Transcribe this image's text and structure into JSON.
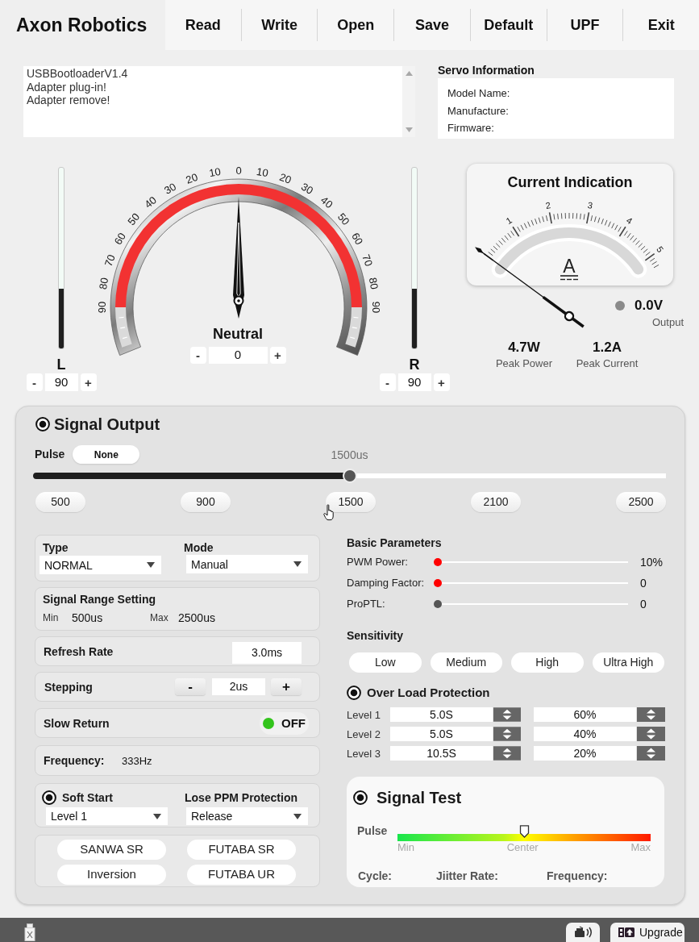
{
  "header": {
    "logo": "Axon Robotics",
    "menu": [
      "Read",
      "Write",
      "Open",
      "Save",
      "Default",
      "UPF",
      "Exit"
    ]
  },
  "log": {
    "lines": [
      "USBBootloaderV1.4",
      "Adapter plug-in!",
      "Adapter remove!"
    ]
  },
  "servo_information": {
    "title": "Servo Information",
    "fields": [
      "Model Name:",
      "Manufacture:",
      "Firmware:"
    ]
  },
  "angle_gauge": {
    "limits": [
      {
        "label": "L",
        "level": 0.33,
        "decrement": "-",
        "value": "90",
        "increment": "+"
      },
      {
        "label": "R",
        "level": 0.33,
        "decrement": "-",
        "value": "90",
        "increment": "+"
      }
    ],
    "scale_labels": [
      "90",
      "80",
      "70",
      "60",
      "50",
      "40",
      "30",
      "20",
      "10",
      "0",
      "10",
      "20",
      "30",
      "40",
      "50",
      "60",
      "70",
      "80",
      "90"
    ],
    "needle": {
      "level": 0.5
    },
    "neutral": {
      "label": "Neutral",
      "decrement": "-",
      "value": "0",
      "increment": "+"
    }
  },
  "current_indication": {
    "title": "Current Indication",
    "scale_labels": [
      "1",
      "2",
      "3",
      "4",
      "5"
    ],
    "unit": "A",
    "needle": {
      "level": 0
    },
    "output": {
      "on": false,
      "value": "0.0V",
      "label": "Output"
    },
    "peaks": [
      {
        "value": "4.7W",
        "label": "Peak Power"
      },
      {
        "value": "1.2A",
        "label": "Peak Current"
      }
    ]
  },
  "signal_output": {
    "title": "Signal Output",
    "checked": true,
    "pulse": {
      "label": "Pulse",
      "mode_button": "None",
      "reading": "1500us",
      "level": 0.5,
      "presets": [
        "500",
        "900",
        "1500",
        "2100",
        "2500"
      ]
    },
    "type": {
      "label": "Type",
      "value": "NORMAL"
    },
    "mode": {
      "label": "Mode",
      "value": "Manual"
    },
    "signal_range": {
      "title": "Signal Range Setting",
      "min_label": "Min",
      "min_value": "500us",
      "max_label": "Max",
      "max_value": "2500us"
    },
    "refresh_rate": {
      "label": "Refresh Rate",
      "value": "3.0ms"
    },
    "stepping": {
      "label": "Stepping",
      "decrement": "-",
      "value": "2us",
      "increment": "+"
    },
    "slow_return": {
      "label": "Slow Return",
      "on": false,
      "state_text": "OFF"
    },
    "frequency": {
      "label": "Frequency:",
      "value": "333Hz"
    },
    "soft_start": {
      "label": "Soft Start",
      "checked": true,
      "value": "Level 1"
    },
    "lose_ppm_protection": {
      "label": "Lose PPM Protection",
      "value": "Release"
    },
    "protocol_buttons": [
      "SANWA SR",
      "FUTABA SR",
      "Inversion",
      "FUTABA UR"
    ],
    "basic_parameters": {
      "title": "Basic Parameters",
      "sliders": [
        {
          "label": "PWM Power:",
          "level": 0,
          "color": "#ff0000",
          "reading": "10%"
        },
        {
          "label": "Damping Factor:",
          "level": 0,
          "color": "#ff0000",
          "reading": "0"
        },
        {
          "label": "ProPTL:",
          "level": 0,
          "color": "#555555",
          "reading": "0"
        }
      ]
    },
    "sensitivity": {
      "title": "Sensitivity",
      "options": [
        {
          "label": "Low",
          "selected": false
        },
        {
          "label": "Medium",
          "selected": false
        },
        {
          "label": "High",
          "selected": false
        },
        {
          "label": "Ultra High",
          "selected": false
        }
      ]
    },
    "over_load_protection": {
      "title": "Over Load Protection",
      "checked": true,
      "levels": [
        {
          "label": "Level 1",
          "time": "5.0S",
          "percent": "60%"
        },
        {
          "label": "Level 2",
          "time": "5.0S",
          "percent": "40%"
        },
        {
          "label": "Level 3",
          "time": "10.5S",
          "percent": "20%"
        }
      ]
    },
    "signal_test": {
      "title": "Signal Test",
      "checked": true,
      "pulse_label": "Pulse",
      "level": 0.5,
      "scale_labels": [
        "Min",
        "Center",
        "Max"
      ],
      "readouts": [
        "Cycle:",
        "Jiitter Rate:",
        "Frequency:"
      ]
    }
  },
  "status_bar": {
    "upgrade_label": "Upgrade"
  }
}
